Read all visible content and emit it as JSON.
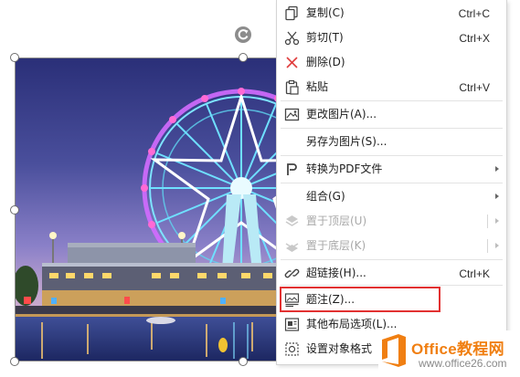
{
  "menu": {
    "items": [
      {
        "label": "复制(C)",
        "shortcut": "Ctrl+C",
        "icon": "copy-icon"
      },
      {
        "label": "剪切(T)",
        "shortcut": "Ctrl+X",
        "icon": "scissors-icon"
      },
      {
        "label": "删除(D)",
        "icon": "delete-x-icon"
      },
      {
        "label": "粘贴",
        "shortcut": "Ctrl+V",
        "icon": "paste-icon"
      },
      {
        "label": "更改图片(A)...",
        "icon": "change-picture-icon"
      },
      {
        "label": "另存为图片(S)..."
      },
      {
        "label": "转换为PDF文件",
        "icon": "pdf-convert-icon",
        "submenu": true
      },
      {
        "label": "组合(G)",
        "submenu": true
      },
      {
        "label": "置于顶层(U)",
        "icon": "bring-to-front-icon",
        "disabled": true,
        "submenu": true
      },
      {
        "label": "置于底层(K)",
        "icon": "send-to-back-icon",
        "disabled": true,
        "submenu": true
      },
      {
        "label": "超链接(H)...",
        "shortcut": "Ctrl+K",
        "icon": "hyperlink-icon"
      },
      {
        "label": "题注(Z)...",
        "icon": "caption-icon",
        "highlighted": true
      },
      {
        "label": "其他布局选项(L)...",
        "icon": "layout-options-icon"
      },
      {
        "label": "设置对象格式",
        "icon": "format-object-icon"
      }
    ]
  },
  "watermark": {
    "brand": "Office教程网",
    "url": "www.office26.com"
  },
  "colors": {
    "highlight_border": "#e23131",
    "watermark_orange": "#f07f12",
    "delete_red": "#e03c3c"
  }
}
